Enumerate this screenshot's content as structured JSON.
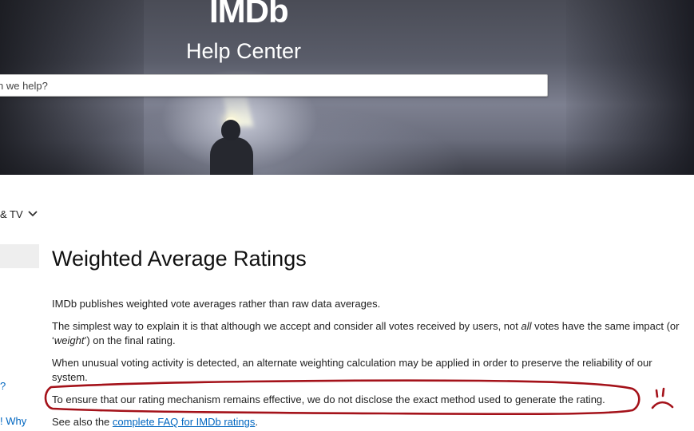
{
  "hero": {
    "logo": "IMDb",
    "title": "Help Center",
    "search_placeholder": "n we help?"
  },
  "nav": {
    "category_select": "& TV",
    "link_1": "?",
    "link_2": "! Why"
  },
  "article": {
    "title": "Weighted Average Ratings",
    "p1": "IMDb publishes weighted vote averages rather than raw data averages.",
    "p2_part1": "The simplest way to explain it is that although we accept and consider all votes received by users, not ",
    "p2_em1": "all",
    "p2_part2": " votes have the same impact (or",
    "p2_part3": "‘",
    "p2_em2": "weight",
    "p2_part4": "’) on the final rating.",
    "p3_line1": "When unusual voting activity is detected, an alternate weighting calculation may be applied in order to preserve the reliability of our",
    "p3_line2": "system.",
    "p4": "To ensure that our rating mechanism remains effective, we do not disclose the exact method used to generate the rating.",
    "p5_prefix": "See also the ",
    "p5_link": "complete FAQ for IMDb ratings",
    "p5_suffix": "."
  },
  "colors": {
    "link": "#0066c0",
    "annotation": "#a4121a"
  },
  "icons": {
    "category_chevron": "chevron-down-icon"
  }
}
